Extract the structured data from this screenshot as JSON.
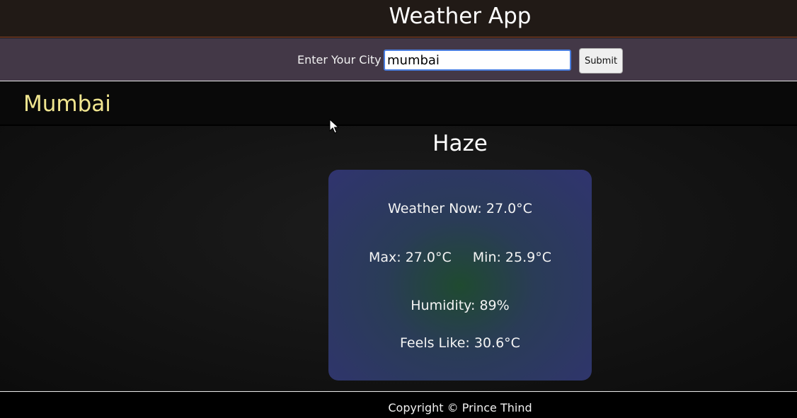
{
  "header": {
    "title": "Weather App"
  },
  "search": {
    "label": "Enter Your City",
    "value": "mumbai",
    "submit_label": "Submit"
  },
  "location": {
    "city": "Mumbai"
  },
  "weather": {
    "condition": "Haze",
    "now": "Weather Now: 27.0°C",
    "max": "Max: 27.0°C",
    "min": "Min: 25.9°C",
    "humidity": "Humidity: 89%",
    "feels_like": "Feels Like: 30.6°C"
  },
  "footer": {
    "copyright": "Copyright © Prince Thind"
  },
  "colors": {
    "header_bg": "#211a16",
    "search_bg": "#433847",
    "city_name": "#f0e58f",
    "card_edge": "#30346f",
    "card_center": "#1f4a30"
  }
}
